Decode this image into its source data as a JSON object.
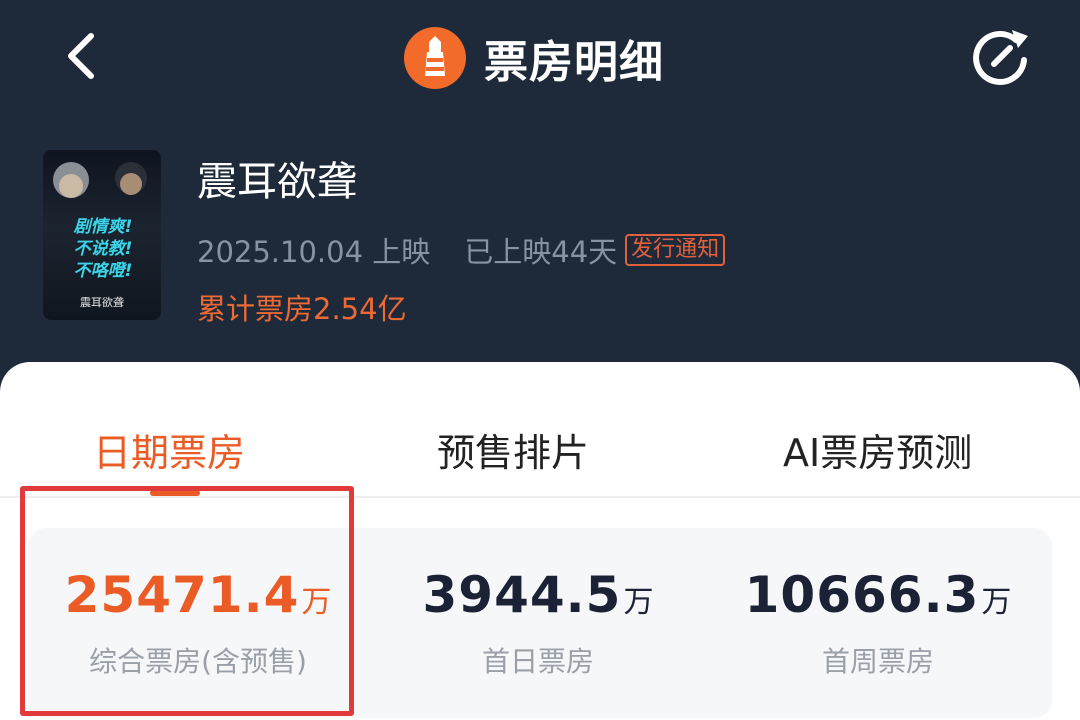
{
  "header": {
    "title": "票房明细",
    "back_icon": "chevron-left-icon",
    "logo_icon": "lighthouse-logo-icon",
    "refresh_icon": "share-refresh-icon"
  },
  "movie": {
    "poster_slogan_1": "剧情爽!",
    "poster_slogan_2": "不说教!",
    "poster_slogan_3": "不咯噔!",
    "poster_title": "震耳欲聋",
    "name": "震耳欲聋",
    "release_date": "2025.10.04 上映",
    "days_released": "已上映44天",
    "release_notice": "发行通知",
    "total_box_office": "累计票房2.54亿"
  },
  "tabs": [
    {
      "label": "日期票房",
      "active": true
    },
    {
      "label": "预售排片",
      "active": false
    },
    {
      "label": "AI票房预测",
      "active": false
    }
  ],
  "stats": [
    {
      "value": "25471.4",
      "unit": "万",
      "label": "综合票房(含预售)"
    },
    {
      "value": "3944.5",
      "unit": "万",
      "label": "首日票房"
    },
    {
      "value": "10666.3",
      "unit": "万",
      "label": "首周票房"
    }
  ],
  "colors": {
    "header_bg": "#1e2a3a",
    "accent": "#ea5b25",
    "highlight_border": "#e23a3a"
  }
}
